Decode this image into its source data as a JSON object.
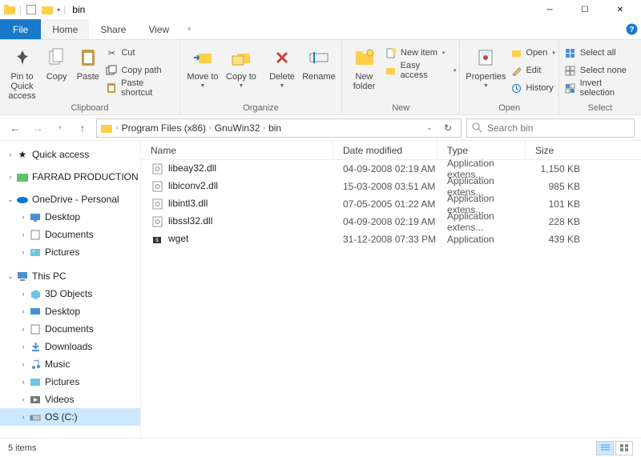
{
  "title_bar": {
    "title": "bin"
  },
  "tabs": {
    "file": "File",
    "home": "Home",
    "share": "Share",
    "view": "View"
  },
  "ribbon": {
    "clipboard": {
      "label": "Clipboard",
      "pin": "Pin to Quick access",
      "copy": "Copy",
      "paste": "Paste",
      "cut": "Cut",
      "copy_path": "Copy path",
      "paste_shortcut": "Paste shortcut"
    },
    "organize": {
      "label": "Organize",
      "move_to": "Move to",
      "copy_to": "Copy to",
      "delete": "Delete",
      "rename": "Rename"
    },
    "new": {
      "label": "New",
      "new_folder": "New folder",
      "new_item": "New item",
      "easy_access": "Easy access"
    },
    "open": {
      "label": "Open",
      "properties": "Properties",
      "open": "Open",
      "edit": "Edit",
      "history": "History"
    },
    "select": {
      "label": "Select",
      "select_all": "Select all",
      "select_none": "Select none",
      "invert": "Invert selection"
    }
  },
  "breadcrumb": {
    "p1": "Program Files (x86)",
    "p2": "GnuWin32",
    "p3": "bin"
  },
  "search": {
    "placeholder": "Search bin"
  },
  "sidebar": {
    "quick_access": "Quick access",
    "farrad": "FARRAD PRODUCTION",
    "onedrive": "OneDrive - Personal",
    "desktop": "Desktop",
    "documents": "Documents",
    "pictures": "Pictures",
    "this_pc": "This PC",
    "objects3d": "3D Objects",
    "downloads": "Downloads",
    "music": "Music",
    "videos": "Videos",
    "os_c": "OS (C:)"
  },
  "columns": {
    "name": "Name",
    "date": "Date modified",
    "type": "Type",
    "size": "Size"
  },
  "files": [
    {
      "name": "libeay32.dll",
      "date": "04-09-2008 02:19 AM",
      "type": "Application extens...",
      "size": "1,150 KB"
    },
    {
      "name": "libiconv2.dll",
      "date": "15-03-2008 03:51 AM",
      "type": "Application extens...",
      "size": "985 KB"
    },
    {
      "name": "libintl3.dll",
      "date": "07-05-2005 01:22 AM",
      "type": "Application extens...",
      "size": "101 KB"
    },
    {
      "name": "libssl32.dll",
      "date": "04-09-2008 02:19 AM",
      "type": "Application extens...",
      "size": "228 KB"
    },
    {
      "name": "wget",
      "date": "31-12-2008 07:33 PM",
      "type": "Application",
      "size": "439 KB"
    }
  ],
  "status": {
    "items": "5 items"
  }
}
